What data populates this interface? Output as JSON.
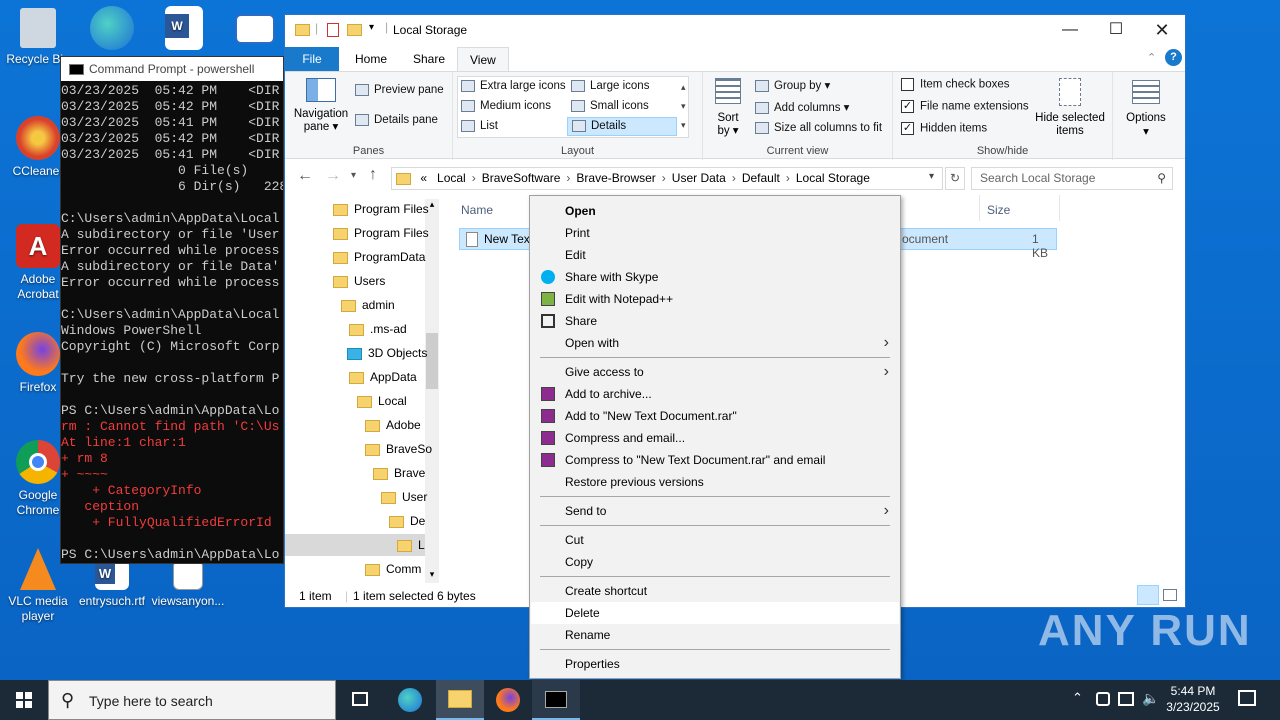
{
  "desktop": {
    "icons": [
      {
        "label": "Recycle Bin",
        "name": "recycle-bin-icon",
        "color": "#cfd8e0"
      },
      {
        "label": "",
        "name": "edge-icon",
        "color": "#1c9ee6"
      },
      {
        "label": "",
        "name": "word-icon",
        "color": "#2b5797"
      },
      {
        "label": "CCleaner",
        "name": "ccleaner-icon",
        "color": "#d9412b"
      },
      {
        "label": "Adobe Acrobat",
        "name": "acrobat-icon",
        "color": "#d22a20"
      },
      {
        "label": "Firefox",
        "name": "firefox-icon",
        "color": "#ff7a1a"
      },
      {
        "label": "Google Chrome",
        "name": "chrome-icon",
        "color": "#2da44e"
      },
      {
        "label": "VLC media player",
        "name": "vlc-icon",
        "color": "#f58a1f"
      },
      {
        "label": "entrysuch.rtf",
        "name": "rtf-file-icon",
        "color": "#ffffff"
      },
      {
        "label": "viewsanyon...",
        "name": "image-file-icon",
        "color": "#ffffff"
      }
    ]
  },
  "cmd": {
    "title": "Command Prompt - powershell",
    "lines": [
      {
        "t": "03/23/2025  05:42 PM    <DIR",
        "c": "n"
      },
      {
        "t": "03/23/2025  05:42 PM    <DIR",
        "c": "n"
      },
      {
        "t": "03/23/2025  05:41 PM    <DIR",
        "c": "n"
      },
      {
        "t": "03/23/2025  05:42 PM    <DIR",
        "c": "n"
      },
      {
        "t": "03/23/2025  05:41 PM    <DIR",
        "c": "n"
      },
      {
        "t": "               0 File(s)",
        "c": "n"
      },
      {
        "t": "               6 Dir(s)   228",
        "c": "n"
      },
      {
        "t": "",
        "c": "n"
      },
      {
        "t": "C:\\Users\\admin\\AppData\\Local",
        "c": "n"
      },
      {
        "t": "A subdirectory or file 'User",
        "c": "n"
      },
      {
        "t": "Error occurred while process",
        "c": "n"
      },
      {
        "t": "A subdirectory or file Data'",
        "c": "n"
      },
      {
        "t": "Error occurred while process",
        "c": "n"
      },
      {
        "t": "",
        "c": "n"
      },
      {
        "t": "C:\\Users\\admin\\AppData\\Local",
        "c": "n"
      },
      {
        "t": "Windows PowerShell",
        "c": "n"
      },
      {
        "t": "Copyright (C) Microsoft Corp",
        "c": "n"
      },
      {
        "t": "",
        "c": "n"
      },
      {
        "t": "Try the new cross-platform P",
        "c": "n"
      },
      {
        "t": "",
        "c": "n"
      },
      {
        "t": "PS C:\\Users\\admin\\AppData\\Lo",
        "c": "n"
      },
      {
        "t": "rm : Cannot find path 'C:\\Us",
        "c": "r"
      },
      {
        "t": "At line:1 char:1",
        "c": "r"
      },
      {
        "t": "+ rm 8",
        "c": "r"
      },
      {
        "t": "+ ~~~~",
        "c": "r"
      },
      {
        "t": "    + CategoryInfo",
        "c": "r"
      },
      {
        "t": "   ception",
        "c": "r"
      },
      {
        "t": "    + FullyQualifiedErrorId",
        "c": "r"
      },
      {
        "t": "",
        "c": "n"
      },
      {
        "t": "PS C:\\Users\\admin\\AppData\\Lo",
        "c": "n"
      }
    ]
  },
  "explorer": {
    "title": "Local Storage",
    "tabs": [
      "File",
      "Home",
      "Share",
      "View"
    ],
    "ribbon": {
      "nav_pane": "Navigation pane",
      "preview_pane": "Preview pane",
      "details_pane": "Details pane",
      "panes_label": "Panes",
      "layout": [
        "Extra large icons",
        "Large icons",
        "Medium icons",
        "Small icons",
        "List",
        "Details"
      ],
      "layout_label": "Layout",
      "sort_by": "Sort by",
      "group_by": "Group by",
      "add_columns": "Add columns",
      "size_all": "Size all columns to fit",
      "current_view_label": "Current view",
      "item_check_boxes": "Item check boxes",
      "file_name_extensions": "File name extensions",
      "hidden_items": "Hidden items",
      "hide_selected": "Hide selected items",
      "show_hide_label": "Show/hide",
      "options": "Options"
    },
    "breadcrumb": [
      "«",
      "Local",
      "BraveSoftware",
      "Brave-Browser",
      "User Data",
      "Default",
      "Local Storage"
    ],
    "search_placeholder": "Search Local Storage",
    "nav_items": [
      "Program Files",
      "Program Files",
      "ProgramData",
      "Users",
      "admin",
      ".ms-ad",
      "3D Objects",
      "AppData",
      "Local",
      "Adobe",
      "BraveSo",
      "Brave",
      "User",
      "De",
      "L",
      "Comm"
    ],
    "columns": {
      "name": "Name",
      "size": "Size"
    },
    "file": {
      "name": "New Text",
      "type": "ocument",
      "size": "1 KB"
    },
    "status": {
      "count": "1 item",
      "selected": "1 item selected",
      "bytes": "6 bytes"
    }
  },
  "context_menu": {
    "items": [
      "Open",
      "Print",
      "Edit",
      "Share with Skype",
      "Edit with Notepad++",
      "Share",
      "Open with",
      "Give access to",
      "Add to archive...",
      "Add to \"New Text Document.rar\"",
      "Compress and email...",
      "Compress to \"New Text Document.rar\" and email",
      "Restore previous versions",
      "Send to",
      "Cut",
      "Copy",
      "Create shortcut",
      "Delete",
      "Rename",
      "Properties"
    ]
  },
  "taskbar": {
    "search_placeholder": "Type here to search",
    "time": "5:44 PM",
    "date": "3/23/2025"
  },
  "watermark": "ANY RUN"
}
